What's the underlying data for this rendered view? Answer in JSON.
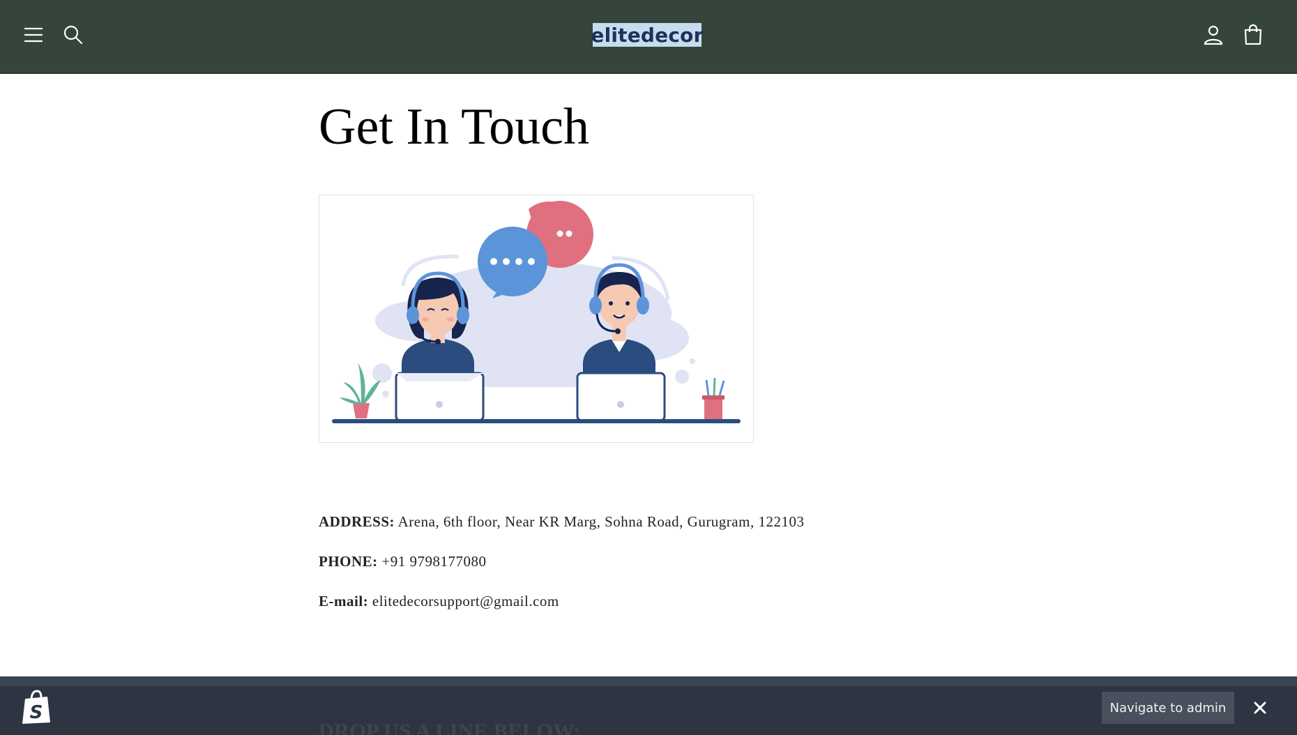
{
  "header": {
    "logo_text": "elitedecor",
    "icons": [
      "menu-icon",
      "search-icon",
      "account-icon",
      "cart-icon"
    ]
  },
  "page": {
    "title": "Get In Touch"
  },
  "contact": {
    "address_label": "ADDRESS:",
    "address_value": "Arena, 6th floor, Near KR Marg, Sohna Road, Gurugram, 122103",
    "phone_label": "PHONE:",
    "phone_value": "+91 9798177080",
    "email_label": "E-mail:",
    "email_value": "elitedecorsupport@gmail.com"
  },
  "form_section": {
    "heading": "DROP US A LINE BELOW:"
  },
  "admin_bar": {
    "navigate_label": "Navigate to admin",
    "icons": [
      "shopify-bag-icon",
      "close-icon"
    ]
  },
  "colors": {
    "header_bg": "#36453b",
    "logo_bg": "#c8dcf1",
    "logo_text": "#1e3157",
    "admin_bar_bg": "#2c3541",
    "admin_button_bg": "#47505c"
  }
}
